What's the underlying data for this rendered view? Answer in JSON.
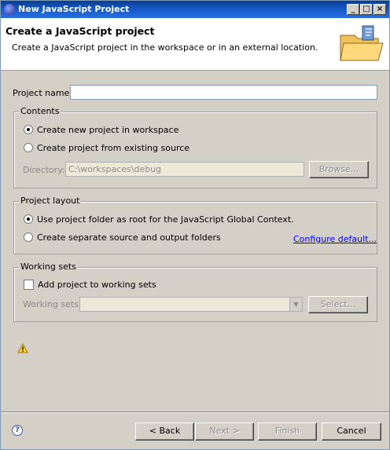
{
  "window": {
    "title": "New JavaScript Project"
  },
  "header": {
    "title": "Create a JavaScript project",
    "description": "Create a JavaScript project in the workspace or in an external location."
  },
  "project_name": {
    "label": "Project name:",
    "value": ""
  },
  "contents": {
    "label": "Contents",
    "option_new": "Create new project in workspace",
    "option_existing": "Create project from existing source",
    "directory_label": "Directory:",
    "directory_value": "C:\\workspaces\\debug",
    "browse_label": "Browse..."
  },
  "layout": {
    "label": "Project layout",
    "option_root": "Use project folder as root for the JavaScript Global Context.",
    "option_separate": "Create separate source and output folders",
    "configure_link": "Configure default..."
  },
  "working_sets": {
    "label": "Working sets",
    "add_label": "Add project to working sets",
    "sets_label": "Working sets:",
    "sets_value": "",
    "select_label": "Select..."
  },
  "buttons": {
    "help": "?",
    "back": "< Back",
    "next": "Next >",
    "finish": "Finish",
    "cancel": "Cancel"
  }
}
